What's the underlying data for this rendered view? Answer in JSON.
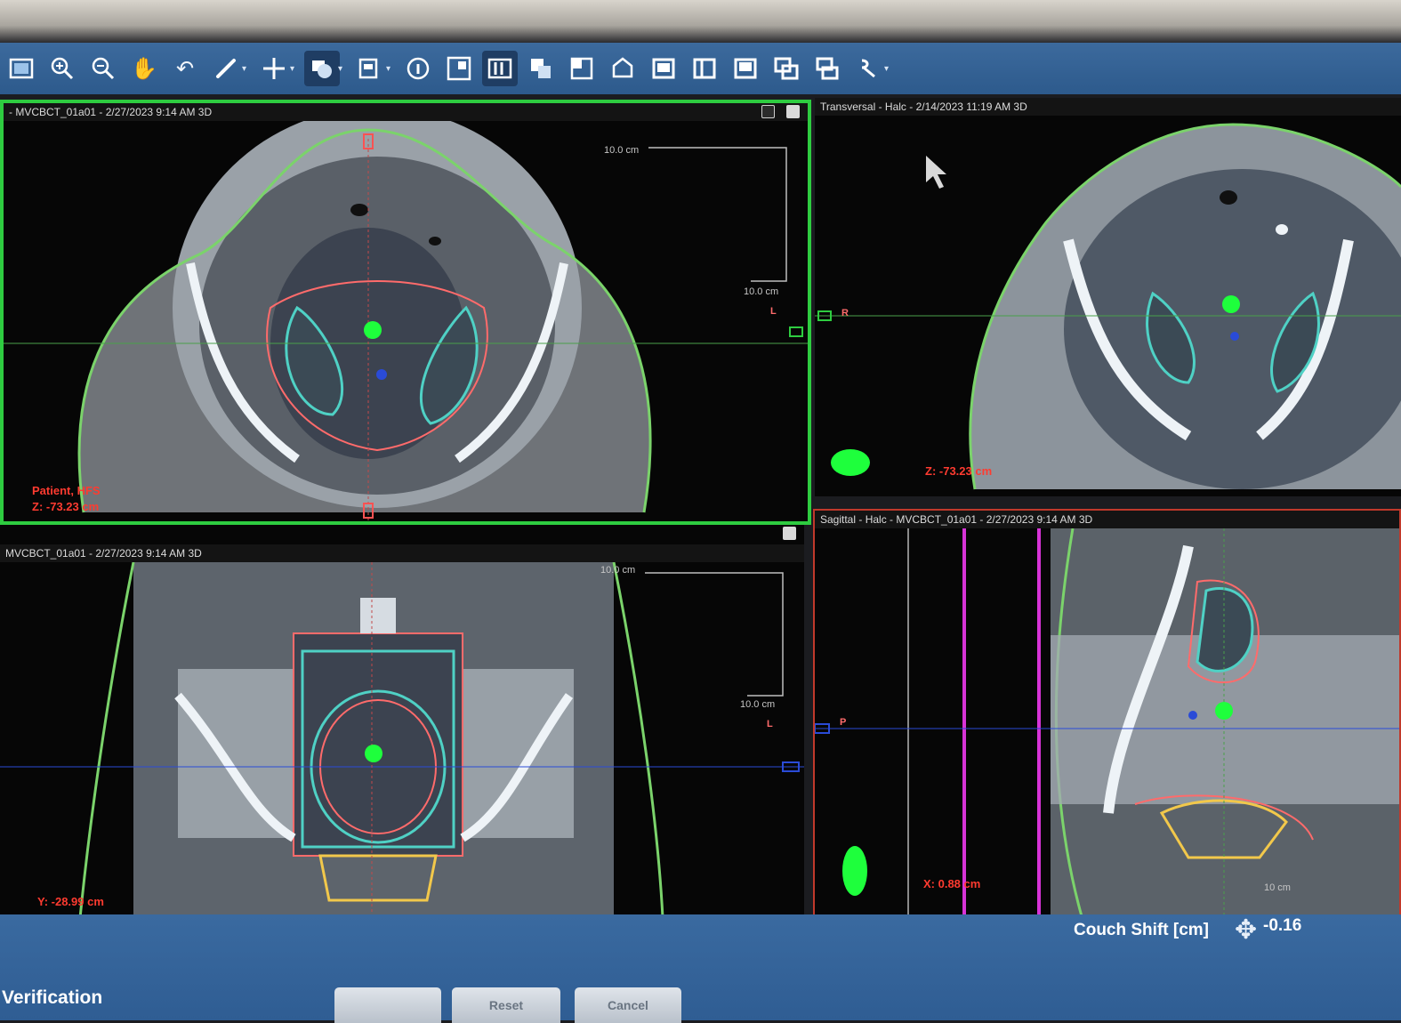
{
  "toolbar": {
    "items": [
      {
        "icon": "image-icon"
      },
      {
        "icon": "zoom-in-icon"
      },
      {
        "icon": "zoom-out-icon"
      },
      {
        "icon": "pan-hand-icon"
      },
      {
        "icon": "undo-icon"
      },
      {
        "icon": "ruler-icon"
      },
      {
        "icon": "crosshair-icon"
      },
      {
        "icon": "window-level-icon"
      },
      {
        "icon": "image-select-icon"
      },
      {
        "icon": "info-icon"
      },
      {
        "icon": "layout-icon"
      },
      {
        "icon": "overlay-icon"
      },
      {
        "icon": "copy-icon"
      },
      {
        "icon": "grid-icon"
      },
      {
        "icon": "shape-icon"
      },
      {
        "icon": "layout-1-icon"
      },
      {
        "icon": "layout-2-icon"
      },
      {
        "icon": "layout-3-icon"
      },
      {
        "icon": "layout-4-icon"
      },
      {
        "icon": "layout-5-icon"
      },
      {
        "icon": "link-icon"
      }
    ]
  },
  "viewports": {
    "top_left": {
      "title": "- MVCBCT_01a01 - 2/27/2023 9:14 AM 3D",
      "scale_top": "10.0 cm",
      "scale_side": "10.0 cm",
      "patient": "Patient, HFS",
      "coord": "Z: -73.23 cm",
      "orient_l": "L"
    },
    "top_right": {
      "title": "Transversal - Halc - 2/14/2023 11:19 AM 3D",
      "orient_r": "R",
      "coord": "Z: -73.23 cm"
    },
    "bottom_left": {
      "title": "MVCBCT_01a01 - 2/27/2023 9:14 AM 3D",
      "scale_top": "10.0 cm",
      "scale_side": "10.0 cm",
      "coord": "Y: -28.99 cm",
      "orient_l": "L"
    },
    "bottom_right": {
      "title": "Sagittal - Halc - MVCBCT_01a01 - 2/27/2023 9:14 AM 3D",
      "orient_p": "P",
      "coord": "X: 0.88 cm",
      "scale": "10 cm"
    }
  },
  "couch": {
    "label": "Couch Shift [cm]",
    "value": "-0.16"
  },
  "footer": {
    "title": "Verification",
    "buttons": [
      "",
      "Reset",
      "Cancel"
    ]
  },
  "colors": {
    "toolbar": "#2d5a8c",
    "active_border": "#2ecc40",
    "body_contour": "#7bd36b",
    "ptv": "#ff6b6b",
    "ctv": "#4fd1c5",
    "isocenter": "#1eff3c"
  }
}
